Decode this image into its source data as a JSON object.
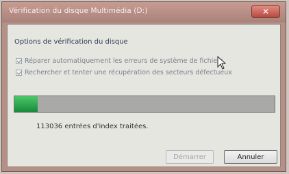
{
  "window": {
    "title": "Vérification du disque Multimédia (D:)",
    "close_label": "✕"
  },
  "options": {
    "group_label": "Options de vérification du disque",
    "items": [
      {
        "label": "Réparer automatiquement les erreurs de système de fichiers",
        "checked": true
      },
      {
        "label": "Rechercher et tenter une récupération des secteurs défectueux",
        "checked": true
      }
    ]
  },
  "progress": {
    "fraction": 0.09,
    "color": "#2fae50"
  },
  "status": {
    "text": "113036 entrées d'index traitées."
  },
  "buttons": {
    "start_label": "Démarrer",
    "cancel_label": "Annuler"
  },
  "icons": {
    "cursor": "mouse-pointer-icon"
  }
}
